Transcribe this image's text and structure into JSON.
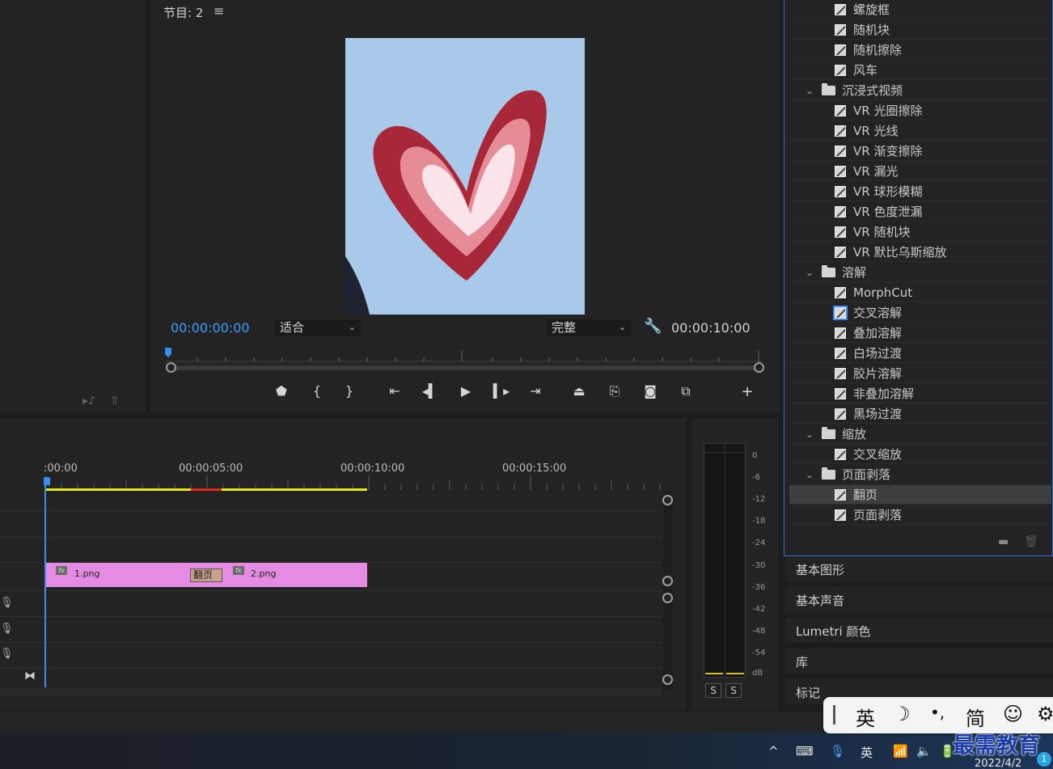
{
  "program_monitor": {
    "title": "节目: 2",
    "menu_glyph": "≡",
    "timecode_current": "00:00:00:00",
    "fit_select": "适合",
    "quality_select": "完整",
    "timecode_duration": "00:00:10:00"
  },
  "timeline": {
    "ruler_labels": [
      ":00:00",
      "00:00:05:00",
      "00:00:10:00",
      "00:00:15:00"
    ],
    "clip1_name": "1.png",
    "clip2_name": "2.png",
    "transition_label": "翻页",
    "fx_label": "fx"
  },
  "audio_meter": {
    "db_labels": [
      "0",
      "-6",
      "-12",
      "-18",
      "-24",
      "-30",
      "-36",
      "-42",
      "-48",
      "-54",
      "dB"
    ],
    "solo_left": "S",
    "solo_right": "S"
  },
  "effects_panel": {
    "rows": [
      {
        "type": "item",
        "label": "螺旋框"
      },
      {
        "type": "item",
        "label": "随机块"
      },
      {
        "type": "item",
        "label": "随机擦除"
      },
      {
        "type": "item",
        "label": "风车"
      },
      {
        "type": "folder",
        "label": "沉浸式视频"
      },
      {
        "type": "item",
        "label": "VR 光圈擦除"
      },
      {
        "type": "item",
        "label": "VR 光线"
      },
      {
        "type": "item",
        "label": "VR 渐变擦除"
      },
      {
        "type": "item",
        "label": "VR 漏光"
      },
      {
        "type": "item",
        "label": "VR 球形模糊"
      },
      {
        "type": "item",
        "label": "VR 色度泄漏"
      },
      {
        "type": "item",
        "label": "VR 随机块"
      },
      {
        "type": "item",
        "label": "VR 默比乌斯缩放"
      },
      {
        "type": "folder",
        "label": "溶解"
      },
      {
        "type": "item",
        "label": "MorphCut"
      },
      {
        "type": "item",
        "label": "交叉溶解"
      },
      {
        "type": "item",
        "label": "叠加溶解"
      },
      {
        "type": "item",
        "label": "白场过渡"
      },
      {
        "type": "item",
        "label": "胶片溶解"
      },
      {
        "type": "item",
        "label": "非叠加溶解"
      },
      {
        "type": "item",
        "label": "黑场过渡"
      },
      {
        "type": "folder",
        "label": "缩放"
      },
      {
        "type": "item",
        "label": "交叉缩放"
      },
      {
        "type": "folder",
        "label": "页面剥落"
      },
      {
        "type": "item",
        "label": "翻页"
      },
      {
        "type": "item",
        "label": "页面剥落"
      }
    ]
  },
  "side_panels": [
    "基本图形",
    "基本声音",
    "Lumetri 颜色",
    "库",
    "标记"
  ],
  "ime_toolbar": {
    "lang": "英",
    "moon": "☽",
    "punct": "•,",
    "simplified": "简",
    "emoji": "☺",
    "gear": "⚙"
  },
  "taskbar": {
    "chevron": "^",
    "ime_lang": "英",
    "date": "2022/4/2",
    "notification_count": "1"
  },
  "watermark": "最需教育"
}
